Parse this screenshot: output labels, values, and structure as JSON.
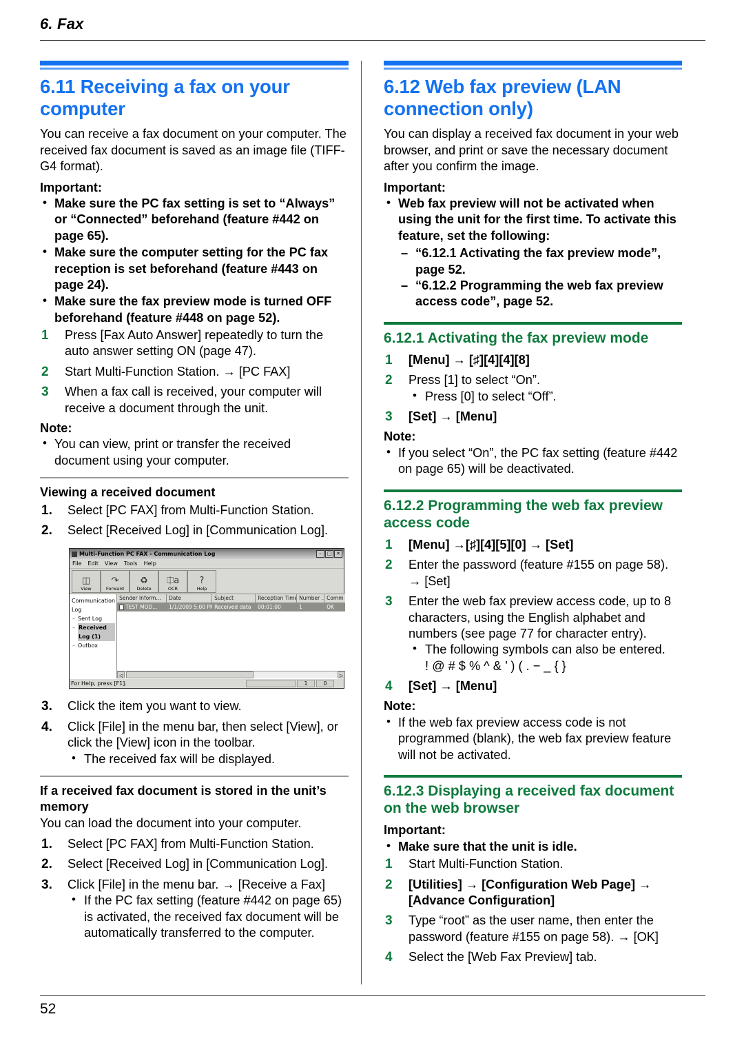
{
  "header": {
    "running_head": "6. Fax"
  },
  "footer": {
    "page_number": "52"
  },
  "left": {
    "section": {
      "number_title": "6.11 Receiving a fax on your computer",
      "intro": "You can receive a fax document on your computer. The received fax document is saved as an image file (TIFF-G4 format).",
      "important_label": "Important:",
      "important_items": [
        "Make sure the PC fax setting is set to “Always” or “Connected” beforehand (feature #442 on page 65).",
        "Make sure the computer setting for the PC fax reception is set beforehand (feature #443 on page 24).",
        "Make sure the fax preview mode is turned OFF beforehand (feature #448 on page 52)."
      ],
      "steps": [
        {
          "num": "1",
          "text": "Press [Fax Auto Answer] repeatedly to turn the auto answer setting ON (page 47)."
        },
        {
          "num": "2",
          "text": "Start Multi-Function Station. → [PC FAX]"
        },
        {
          "num": "3",
          "text": "When a fax call is received, your computer will receive a document through the unit."
        }
      ],
      "note_label": "Note:",
      "note_items": [
        "You can view, print or transfer the received document using your computer."
      ]
    },
    "viewing": {
      "heading": "Viewing a received document",
      "steps_before": [
        {
          "num": "1.",
          "text": "Select [PC FAX] from Multi-Function Station."
        },
        {
          "num": "2.",
          "text": "Select [Received Log] in [Communication Log]."
        }
      ],
      "steps_after": [
        {
          "num": "3.",
          "text": "Click the item you want to view."
        },
        {
          "num": "4.",
          "text": "Click [File] in the menu bar, then select [View], or click the [View] icon in the toolbar.",
          "sub": "The received fax will be displayed."
        }
      ]
    },
    "memory": {
      "heading": "If a received fax document is stored in the unit’s memory",
      "intro": "You can load the document into your computer.",
      "steps": [
        {
          "num": "1.",
          "text": "Select [PC FAX] from Multi-Function Station."
        },
        {
          "num": "2.",
          "text": "Select [Received Log] in [Communication Log]."
        },
        {
          "num": "3.",
          "text": "Click [File] in the menu bar. → [Receive a Fax]",
          "sub": "If the PC fax setting (feature #442 on page 65) is activated, the received fax document will be automatically transferred to the computer."
        }
      ]
    },
    "screenshot": {
      "title": "Multi-Function PC FAX - Communication Log",
      "window_buttons": [
        "–",
        "□",
        "✕"
      ],
      "menu": [
        "File",
        "Edit",
        "View",
        "Tools",
        "Help"
      ],
      "toolbar": [
        {
          "label": "View",
          "icon": "view-icon",
          "glyph": "🖹"
        },
        {
          "label": "Forward",
          "icon": "forward-icon",
          "glyph": "↪"
        },
        {
          "label": "Delete",
          "icon": "delete-icon",
          "glyph": "🗑"
        },
        {
          "label": "OCR",
          "icon": "ocr-icon",
          "glyph": "ⓐ"
        },
        {
          "label": "Help",
          "icon": "help-icon",
          "glyph": "?"
        }
      ],
      "tree": {
        "root": "Communication Log",
        "children": [
          "Sent Log",
          "Received Log (1)",
          "Outbox"
        ],
        "selected": "Received Log (1)"
      },
      "columns": [
        "Sender Inform...",
        "Date",
        "Subject",
        "Reception Time",
        "Number ...",
        "Comm"
      ],
      "rows": [
        [
          "TEST MOD...",
          "1/1/2009 5:00 PM",
          "Received data",
          "00:01:00",
          "1",
          "OK"
        ]
      ],
      "status": {
        "text": "For Help, press [F1].",
        "count_a": "1",
        "count_b": "0"
      }
    }
  },
  "right": {
    "section": {
      "number_title": "6.12 Web fax preview (LAN connection only)",
      "intro": "You can display a received fax document in your web browser, and print or save the necessary document after you confirm the image.",
      "important_label": "Important:",
      "important_items": [
        "Web fax preview will not be activated when using the unit for the first time. To activate this feature, set the following:"
      ],
      "dash_items": [
        "“6.12.1 Activating the fax preview mode”, page 52.",
        "“6.12.2 Programming the web fax preview access code”, page 52."
      ]
    },
    "sub1": {
      "heading": "6.12.1 Activating the fax preview mode",
      "steps": [
        {
          "num": "1",
          "text": "[Menu] → [♯][4][4][8]",
          "bold": true
        },
        {
          "num": "2",
          "text": "Press [1] to select “On”.",
          "sub": "Press [0] to select “Off”."
        },
        {
          "num": "3",
          "text": "[Set] → [Menu]",
          "bold": true
        }
      ],
      "note_label": "Note:",
      "note_items": [
        "If you select “On”, the PC fax setting (feature #442 on page 65) will be deactivated."
      ]
    },
    "sub2": {
      "heading": "6.12.2 Programming the web fax preview access code",
      "steps": [
        {
          "num": "1",
          "text": "[Menu] →[♯][4][5][0] → [Set]",
          "bold": true
        },
        {
          "num": "2",
          "text": "Enter the password (feature #155 on page 58). → [Set]"
        },
        {
          "num": "3",
          "text": "Enter the web fax preview access code, up to 8 characters, using the English alphabet and numbers (see page 77 for character entry).",
          "sub": "The following symbols can also be entered.",
          "symbols": "! @ # $ % ^ & ’ ) ( . − _ { }"
        },
        {
          "num": "4",
          "text": "[Set] → [Menu]",
          "bold": true
        }
      ],
      "note_label": "Note:",
      "note_items": [
        "If the web fax preview access code is not programmed (blank), the web fax preview feature will not be activated."
      ]
    },
    "sub3": {
      "heading": "6.12.3 Displaying a received fax document on the web browser",
      "important_label": "Important:",
      "important_items": [
        "Make sure that the unit is idle."
      ],
      "steps": [
        {
          "num": "1",
          "text": "Start Multi-Function Station."
        },
        {
          "num": "2",
          "text": "[Utilities] → [Configuration Web Page] → [Advance Configuration]",
          "bold": true
        },
        {
          "num": "3",
          "text": "Type “root” as the user name, then enter the password (feature #155 on page 58). → [OK]"
        },
        {
          "num": "4",
          "text": "Select the [Web Fax Preview] tab."
        }
      ]
    }
  },
  "colors": {
    "heading_blue": "#1472f0",
    "heading_green": "#0f7a3d",
    "rule_gray": "#9a9a9a"
  }
}
